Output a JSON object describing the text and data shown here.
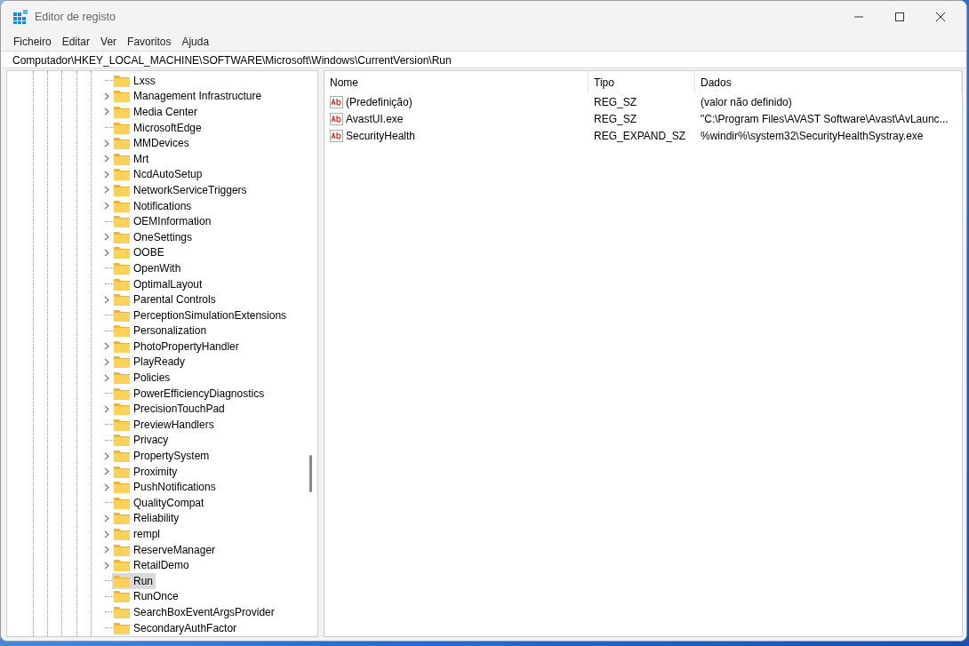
{
  "window": {
    "title": "Editor de registo"
  },
  "menu": [
    "Ficheiro",
    "Editar",
    "Ver",
    "Favoritos",
    "Ajuda"
  ],
  "address": "Computador\\HKEY_LOCAL_MACHINE\\SOFTWARE\\Microsoft\\Windows\\CurrentVersion\\Run",
  "tree": {
    "items": [
      {
        "label": "Lxss",
        "expandable": false,
        "selected": false
      },
      {
        "label": "Management Infrastructure",
        "expandable": true,
        "selected": false
      },
      {
        "label": "Media Center",
        "expandable": true,
        "selected": false
      },
      {
        "label": "MicrosoftEdge",
        "expandable": false,
        "selected": false
      },
      {
        "label": "MMDevices",
        "expandable": true,
        "selected": false
      },
      {
        "label": "Mrt",
        "expandable": true,
        "selected": false
      },
      {
        "label": "NcdAutoSetup",
        "expandable": true,
        "selected": false
      },
      {
        "label": "NetworkServiceTriggers",
        "expandable": true,
        "selected": false
      },
      {
        "label": "Notifications",
        "expandable": true,
        "selected": false
      },
      {
        "label": "OEMInformation",
        "expandable": false,
        "selected": false
      },
      {
        "label": "OneSettings",
        "expandable": true,
        "selected": false
      },
      {
        "label": "OOBE",
        "expandable": true,
        "selected": false
      },
      {
        "label": "OpenWith",
        "expandable": false,
        "selected": false
      },
      {
        "label": "OptimalLayout",
        "expandable": false,
        "selected": false
      },
      {
        "label": "Parental Controls",
        "expandable": true,
        "selected": false
      },
      {
        "label": "PerceptionSimulationExtensions",
        "expandable": false,
        "selected": false
      },
      {
        "label": "Personalization",
        "expandable": false,
        "selected": false
      },
      {
        "label": "PhotoPropertyHandler",
        "expandable": true,
        "selected": false
      },
      {
        "label": "PlayReady",
        "expandable": true,
        "selected": false
      },
      {
        "label": "Policies",
        "expandable": true,
        "selected": false
      },
      {
        "label": "PowerEfficiencyDiagnostics",
        "expandable": false,
        "selected": false
      },
      {
        "label": "PrecisionTouchPad",
        "expandable": true,
        "selected": false
      },
      {
        "label": "PreviewHandlers",
        "expandable": false,
        "selected": false
      },
      {
        "label": "Privacy",
        "expandable": false,
        "selected": false
      },
      {
        "label": "PropertySystem",
        "expandable": true,
        "selected": false
      },
      {
        "label": "Proximity",
        "expandable": true,
        "selected": false
      },
      {
        "label": "PushNotifications",
        "expandable": true,
        "selected": false
      },
      {
        "label": "QualityCompat",
        "expandable": false,
        "selected": false
      },
      {
        "label": "Reliability",
        "expandable": true,
        "selected": false
      },
      {
        "label": "rempl",
        "expandable": true,
        "selected": false
      },
      {
        "label": "ReserveManager",
        "expandable": true,
        "selected": false
      },
      {
        "label": "RetailDemo",
        "expandable": true,
        "selected": false
      },
      {
        "label": "Run",
        "expandable": false,
        "selected": true
      },
      {
        "label": "RunOnce",
        "expandable": false,
        "selected": false
      },
      {
        "label": "SearchBoxEventArgsProvider",
        "expandable": false,
        "selected": false
      },
      {
        "label": "SecondaryAuthFactor",
        "expandable": false,
        "selected": false
      }
    ]
  },
  "table": {
    "columns": [
      "Nome",
      "Tipo",
      "Dados"
    ],
    "rows": [
      {
        "name": "(Predefinição)",
        "type": "REG_SZ",
        "data": "(valor não definido)"
      },
      {
        "name": "AvastUI.exe",
        "type": "REG_SZ",
        "data": "\"C:\\Program Files\\AVAST Software\\Avast\\AvLaunc..."
      },
      {
        "name": "SecurityHealth",
        "type": "REG_EXPAND_SZ",
        "data": "%windir%\\system32\\SecurityHealthSystray.exe"
      }
    ]
  }
}
